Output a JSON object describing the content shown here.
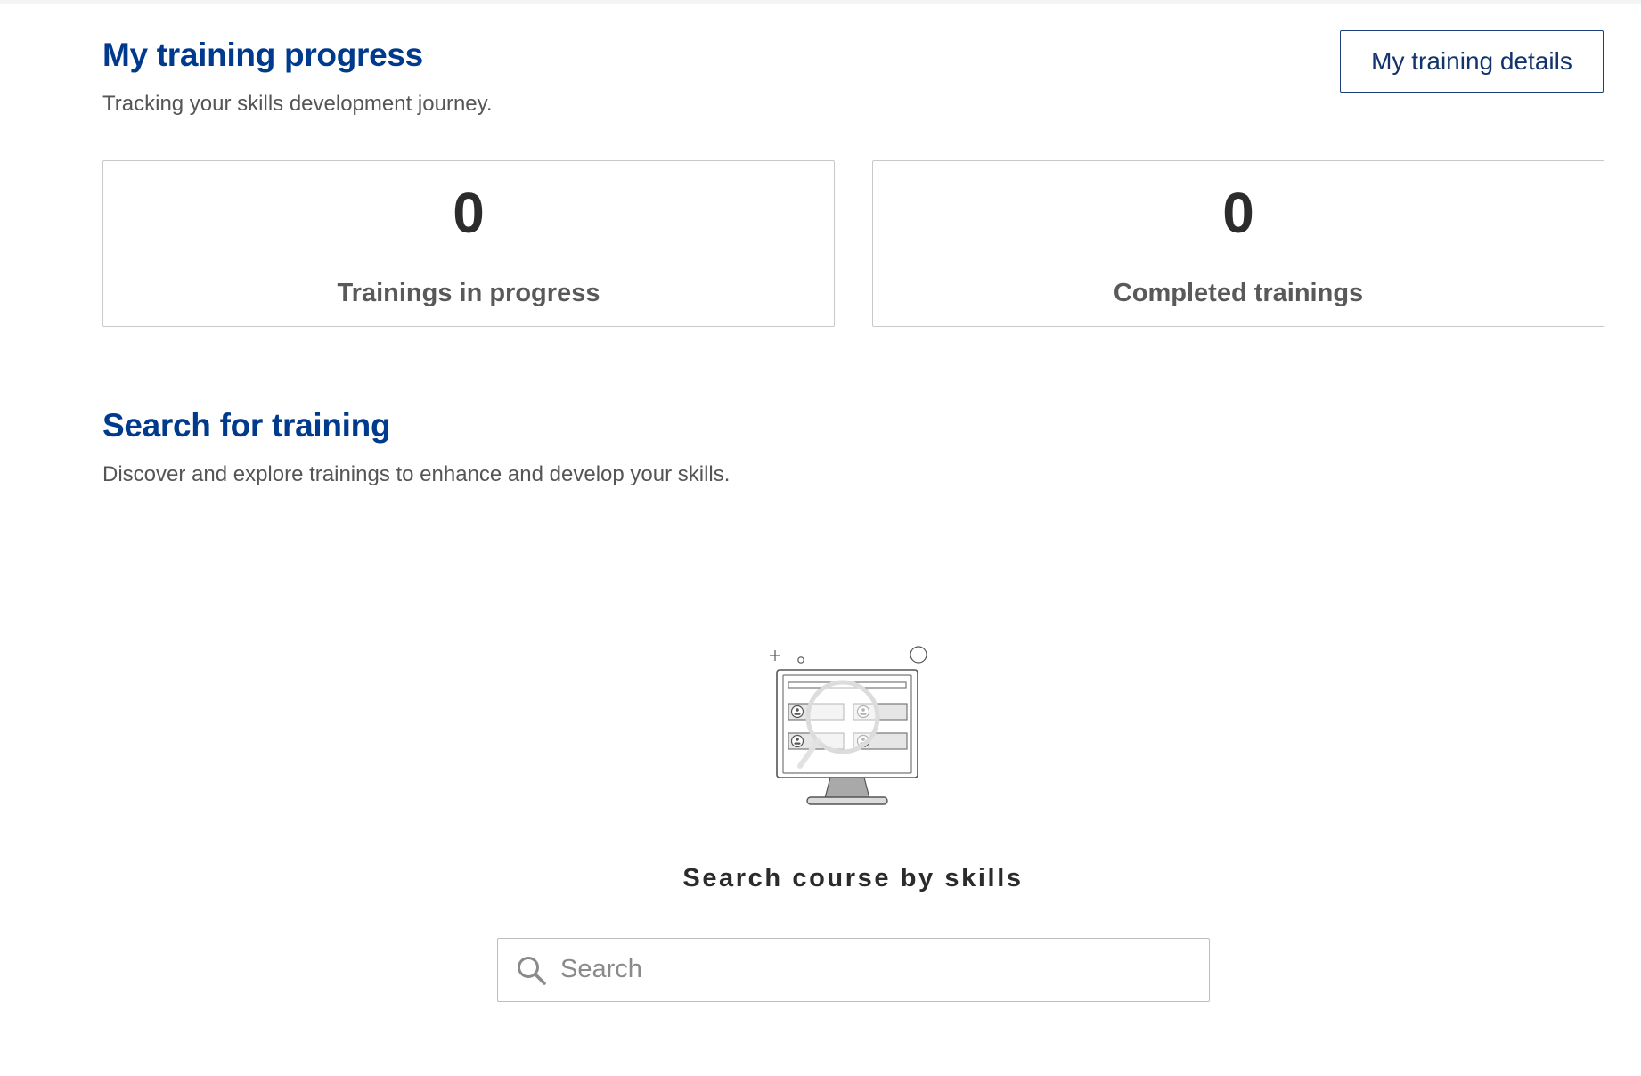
{
  "progress": {
    "title": "My training progress",
    "subtitle": "Tracking your skills development journey.",
    "details_button": "My training details",
    "stats": [
      {
        "value": "0",
        "label": "Trainings in progress"
      },
      {
        "value": "0",
        "label": "Completed trainings"
      }
    ]
  },
  "search_section": {
    "title": "Search for training",
    "subtitle": "Discover and explore trainings to enhance and develop your skills.",
    "empty_state_title": "Search course by skills",
    "search_placeholder": "Search"
  },
  "colors": {
    "heading_blue": "#003a8c",
    "button_border": "#1a3f7a",
    "card_border": "#c9c9c9"
  }
}
